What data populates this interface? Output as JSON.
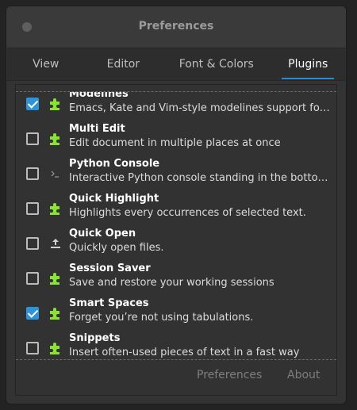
{
  "window": {
    "title": "Preferences"
  },
  "tabs": [
    {
      "label": "View",
      "active": false
    },
    {
      "label": "Editor",
      "active": false
    },
    {
      "label": "Font & Colors",
      "active": false
    },
    {
      "label": "Plugins",
      "active": true
    }
  ],
  "plugins": [
    {
      "name": "Modelines",
      "desc": "Emacs, Kate and Vim-style modelines support for gedit.",
      "checked": true,
      "icon": "puzzle-icon"
    },
    {
      "name": "Multi Edit",
      "desc": "Edit document in multiple places at once",
      "checked": false,
      "icon": "puzzle-icon"
    },
    {
      "name": "Python Console",
      "desc": "Interactive Python console standing in the bottom panel",
      "checked": false,
      "icon": "terminal-icon"
    },
    {
      "name": "Quick Highlight",
      "desc": "Highlights every occurrences of selected text.",
      "checked": false,
      "icon": "puzzle-icon"
    },
    {
      "name": "Quick Open",
      "desc": "Quickly open files.",
      "checked": false,
      "icon": "upload-icon"
    },
    {
      "name": "Session Saver",
      "desc": "Save and restore your working sessions",
      "checked": false,
      "icon": "puzzle-icon"
    },
    {
      "name": "Smart Spaces",
      "desc": "Forget you’re not using tabulations.",
      "checked": true,
      "icon": "puzzle-icon"
    },
    {
      "name": "Snippets",
      "desc": "Insert often-used pieces of text in a fast way",
      "checked": false,
      "icon": "puzzle-icon"
    }
  ],
  "footer": {
    "preferences_label": "Preferences",
    "about_label": "About"
  },
  "colors": {
    "accent": "#2e93d8",
    "puzzle": "#8ae234"
  }
}
